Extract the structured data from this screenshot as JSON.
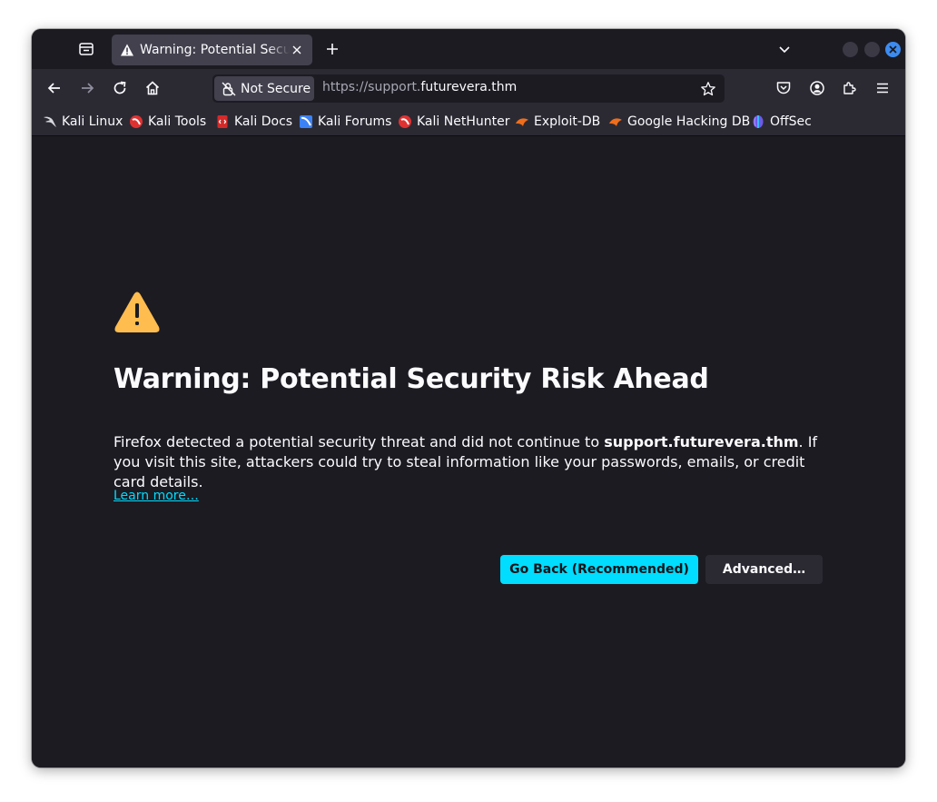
{
  "tab": {
    "title": "Warning: Potential Security Risk Ahead",
    "icon": "warning-icon"
  },
  "urlbar": {
    "identity_label": "Not Secure",
    "url_scheme_prefix": "https://support.",
    "url_host": "futurevera.thm"
  },
  "bookmarks": [
    {
      "label": "Kali Linux",
      "icon": "kali-dragon-icon"
    },
    {
      "label": "Kali Tools",
      "icon": "kali-tools-icon"
    },
    {
      "label": "Kali Docs",
      "icon": "kali-docs-icon"
    },
    {
      "label": "Kali Forums",
      "icon": "kali-forums-icon"
    },
    {
      "label": "Kali NetHunter",
      "icon": "kali-nethunter-icon"
    },
    {
      "label": "Exploit-DB",
      "icon": "exploit-db-icon"
    },
    {
      "label": "Google Hacking DB",
      "icon": "ghdb-icon"
    },
    {
      "label": "OffSec",
      "icon": "offsec-icon"
    }
  ],
  "error_page": {
    "title": "Warning: Potential Security Risk Ahead",
    "desc_before": "Firefox detected a potential security threat and did not continue to ",
    "desc_host": "support.futurevera.thm",
    "desc_after": ". If you visit this site, attackers could try to steal information like your passwords, emails, or credit card details.",
    "learn_more": "Learn more…",
    "go_back_label": "Go Back (Recommended)",
    "advanced_label": "Advanced…"
  },
  "colors": {
    "accent": "#00ddff",
    "warning": "#ffbd4f",
    "background": "#1c1b22",
    "toolbar": "#2b2a33"
  }
}
